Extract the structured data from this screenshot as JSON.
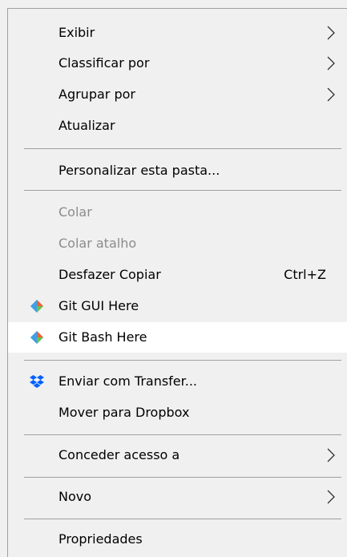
{
  "menu": {
    "items": {
      "exibir": {
        "label": "Exibir"
      },
      "classificar": {
        "label": "Classificar por"
      },
      "agrupar": {
        "label": "Agrupar por"
      },
      "atualizar": {
        "label": "Atualizar"
      },
      "personalizar": {
        "label": "Personalizar esta pasta..."
      },
      "colar": {
        "label": "Colar"
      },
      "colar_atalho": {
        "label": "Colar atalho"
      },
      "desfazer": {
        "label": "Desfazer Copiar",
        "shortcut": "Ctrl+Z"
      },
      "git_gui": {
        "label": "Git GUI Here",
        "icon": "git-icon"
      },
      "git_bash": {
        "label": "Git Bash Here",
        "icon": "git-icon"
      },
      "enviar_transfer": {
        "label": "Enviar com Transfer...",
        "icon": "dropbox-icon"
      },
      "mover_dropbox": {
        "label": "Mover para Dropbox"
      },
      "conceder": {
        "label": "Conceder acesso a"
      },
      "novo": {
        "label": "Novo"
      },
      "propriedades": {
        "label": "Propriedades"
      }
    }
  },
  "colors": {
    "background": "#f0f0f0",
    "hover": "#ffffff",
    "separator": "#a0a0a0",
    "disabled_text": "#8c8c8c",
    "dropbox_blue": "#0061ff"
  }
}
